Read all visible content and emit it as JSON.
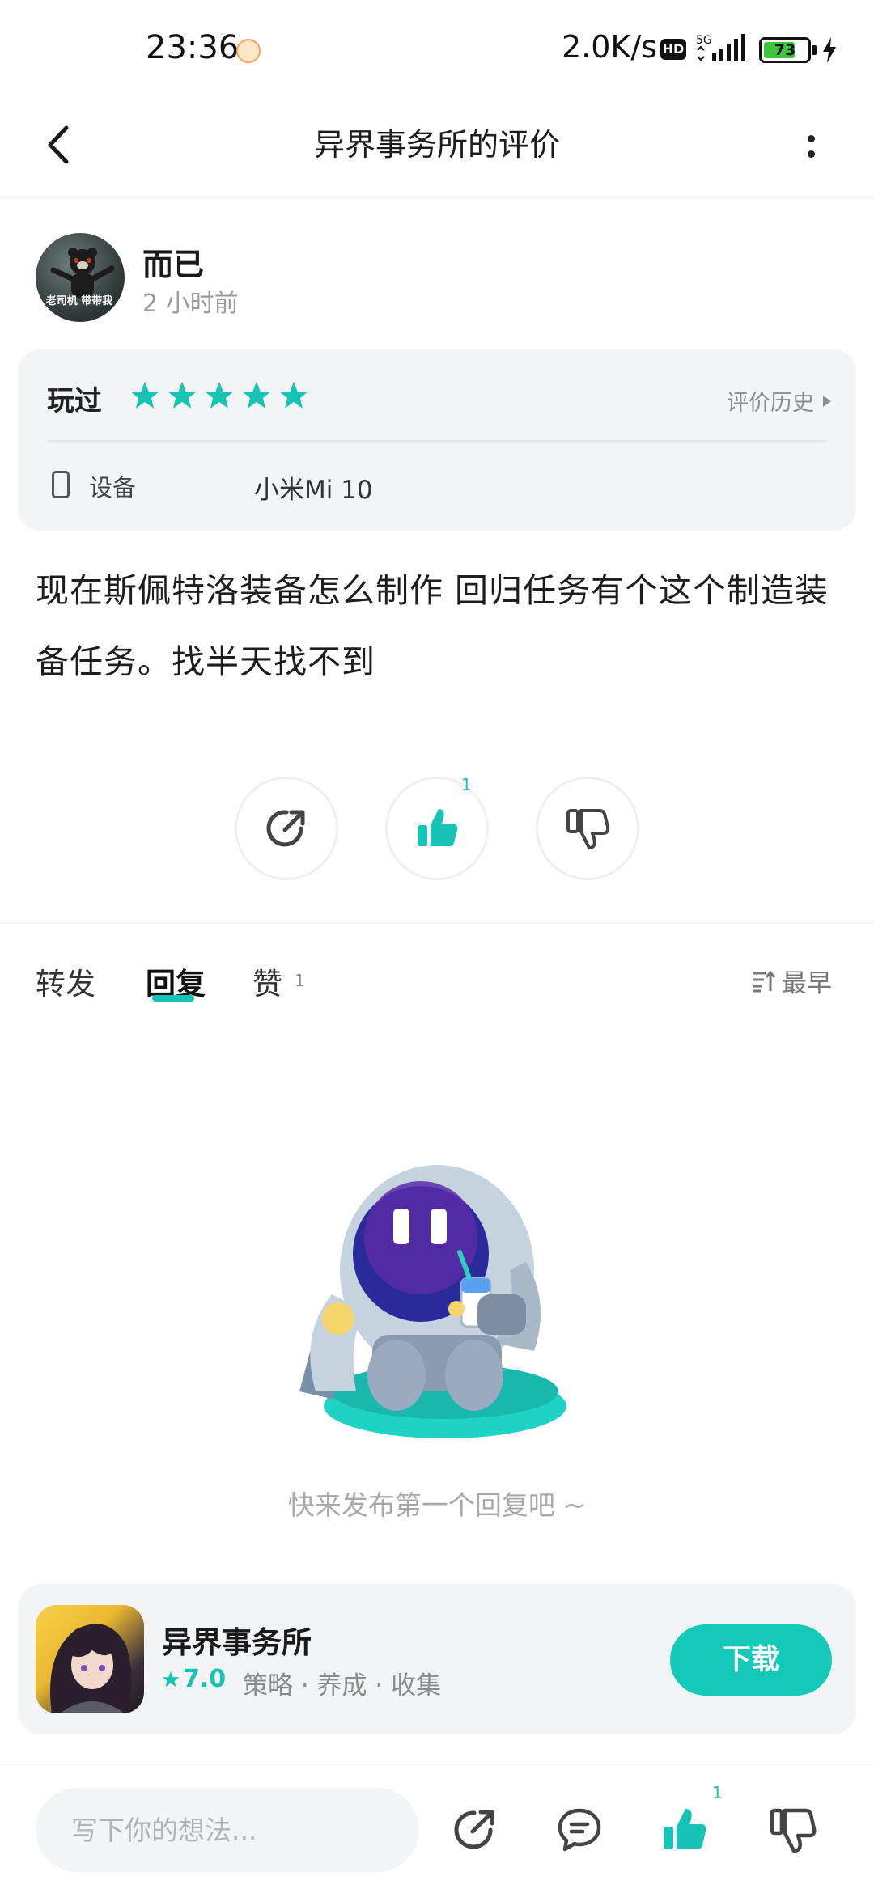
{
  "status_bar": {
    "time": "23:36",
    "net_speed": "2.0K/s",
    "hd": "HD",
    "network": "5G",
    "battery": "73",
    "battery_level": 0.73
  },
  "header": {
    "title": "异界事务所的评价"
  },
  "user": {
    "name": "而已",
    "time_ago": "2 小时前",
    "avatar_caption": "老司机 带带我"
  },
  "info_card": {
    "played_label": "玩过",
    "stars": 5,
    "history_label": "评价历史",
    "device_label": "设备",
    "device_value": "小米Mi 10"
  },
  "review": {
    "text": "现在斯佩特洛装备怎么制作 回归任务有个这个制造装备任务。找半天找不到"
  },
  "actions": {
    "like_count": "1"
  },
  "tabs": {
    "items": [
      "转发",
      "回复",
      "赞"
    ],
    "like_count": "1",
    "sort_label": "最早"
  },
  "empty_state": {
    "text": "快来发布第一个回复吧 ~"
  },
  "app_card": {
    "name": "异界事务所",
    "rating": "7.0",
    "tags": "策略 · 养成 · 收集",
    "download_label": "下载"
  },
  "bottom_bar": {
    "placeholder": "写下你的想法...",
    "like_count": "1"
  },
  "colors": {
    "accent": "#15c4b5",
    "card_bg": "#f3f4f6"
  }
}
